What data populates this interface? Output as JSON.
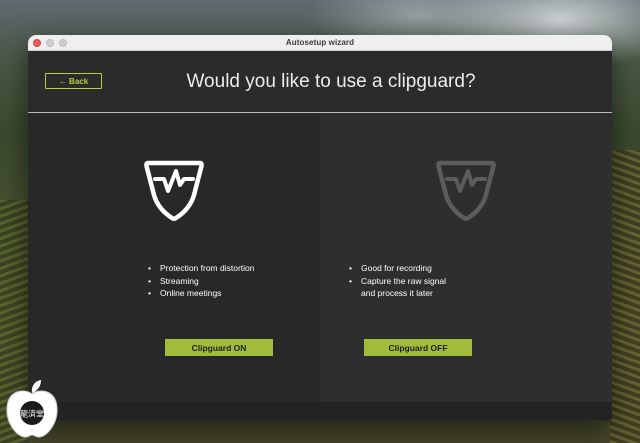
{
  "window": {
    "title": "Autosetup wizard"
  },
  "header": {
    "back_label": "← Back",
    "title": "Would you like to use a clipguard?"
  },
  "panels": {
    "on": {
      "icon": "clipguard-shield-icon",
      "features": [
        "Protection from distortion",
        "Streaming",
        "Online meetings"
      ],
      "button_label": "Clipguard ON"
    },
    "off": {
      "icon": "clipguard-shield-icon",
      "features": [
        "Good for recording",
        "Capture the raw signal",
        "and process it later"
      ],
      "button_label": "Clipguard OFF"
    }
  },
  "watermark": {
    "text": "龍済堂"
  },
  "colors": {
    "accent": "#a1bc3b",
    "back_outline": "#b6cf3e",
    "window_bg": "#2a2a2a",
    "icon_on": "#ffffff",
    "icon_off": "#5c5c5c"
  }
}
